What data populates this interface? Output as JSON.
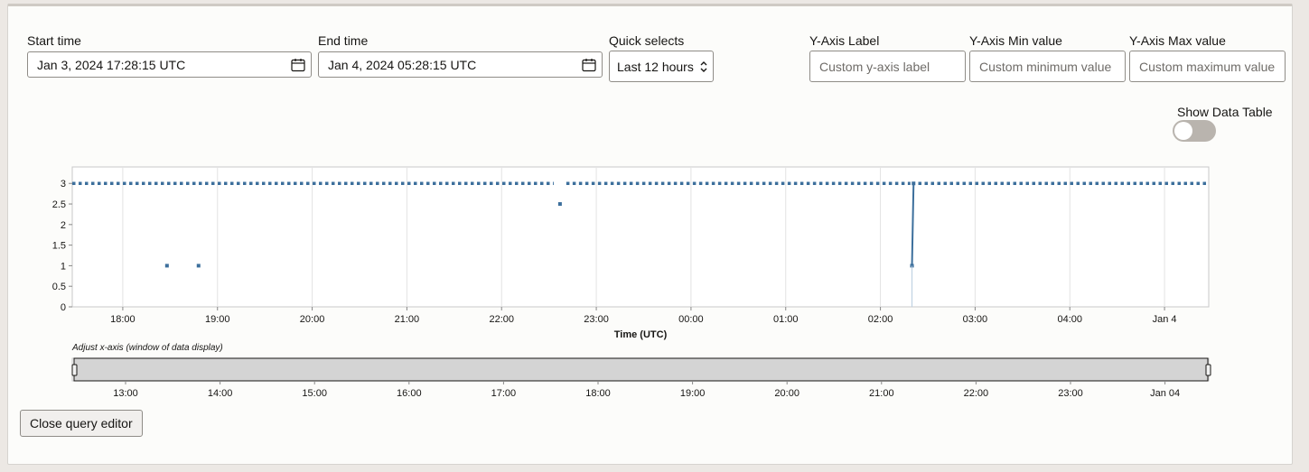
{
  "form": {
    "start_time": {
      "label": "Start time",
      "value": "Jan 3, 2024 17:28:15 UTC"
    },
    "end_time": {
      "label": "End time",
      "value": "Jan 4, 2024 05:28:15 UTC"
    },
    "quick_selects": {
      "label": "Quick selects",
      "value": "Last 12 hours"
    },
    "y_axis_label": {
      "label": "Y-Axis Label",
      "placeholder": "Custom y-axis label"
    },
    "y_axis_min": {
      "label": "Y-Axis Min value",
      "placeholder": "Custom minimum value"
    },
    "y_axis_max": {
      "label": "Y-Axis Max value",
      "placeholder": "Custom maximum value"
    }
  },
  "show_data_table": {
    "label": "Show Data Table",
    "on": false
  },
  "slider": {
    "caption": "Adjust x-axis (window of data display)"
  },
  "close_button": {
    "label": "Close query editor"
  },
  "icons": {
    "calendar": "calendar-icon",
    "select": "updown-chevron-icon",
    "handle": "drag-handle-icon"
  },
  "colors": {
    "series": "#3c6f9c",
    "brush": "#d4d4d4"
  },
  "chart_data": [
    {
      "type": "line",
      "xlabel": "Time (UTC)",
      "ylabel": "",
      "ylim": [
        0,
        3.4
      ],
      "y_ticks": [
        0,
        0.5,
        1,
        1.5,
        2,
        2.5,
        3
      ],
      "y_tick_labels": [
        "0",
        "0.5",
        "1",
        "1.5",
        "2",
        "2.5",
        "3"
      ],
      "x_ticks": [
        "18:00",
        "19:00",
        "20:00",
        "21:00",
        "22:00",
        "23:00",
        "00:00",
        "01:00",
        "02:00",
        "03:00",
        "04:00",
        "Jan 4"
      ],
      "grid": true,
      "series": [
        {
          "values_note": "",
          "points": [
            {
              "t": "Jan 3 18:28",
              "y": 1
            },
            {
              "t": "Jan 3 18:48",
              "y": 1
            },
            {
              "t": "Jan 3 22:37",
              "y": 2.5
            },
            {
              "t": "Jan 4 02:20",
              "y": 1
            },
            {
              "t": "Jan 4 02:21",
              "y": 3
            }
          ],
          "constant_segments": [
            {
              "from": "Jan 3 17:28",
              "to": "Jan 3 22:33",
              "y": 3
            },
            {
              "from": "Jan 3 22:41",
              "to": "Jan 4 02:19",
              "y": 3
            },
            {
              "from": "Jan 4 02:24",
              "to": "Jan 4 05:28",
              "y": 3
            }
          ]
        }
      ]
    },
    {
      "type": "area",
      "x_ticks": [
        "13:00",
        "14:00",
        "15:00",
        "16:00",
        "17:00",
        "18:00",
        "19:00",
        "20:00",
        "21:00",
        "22:00",
        "23:00",
        "Jan 04"
      ]
    }
  ]
}
